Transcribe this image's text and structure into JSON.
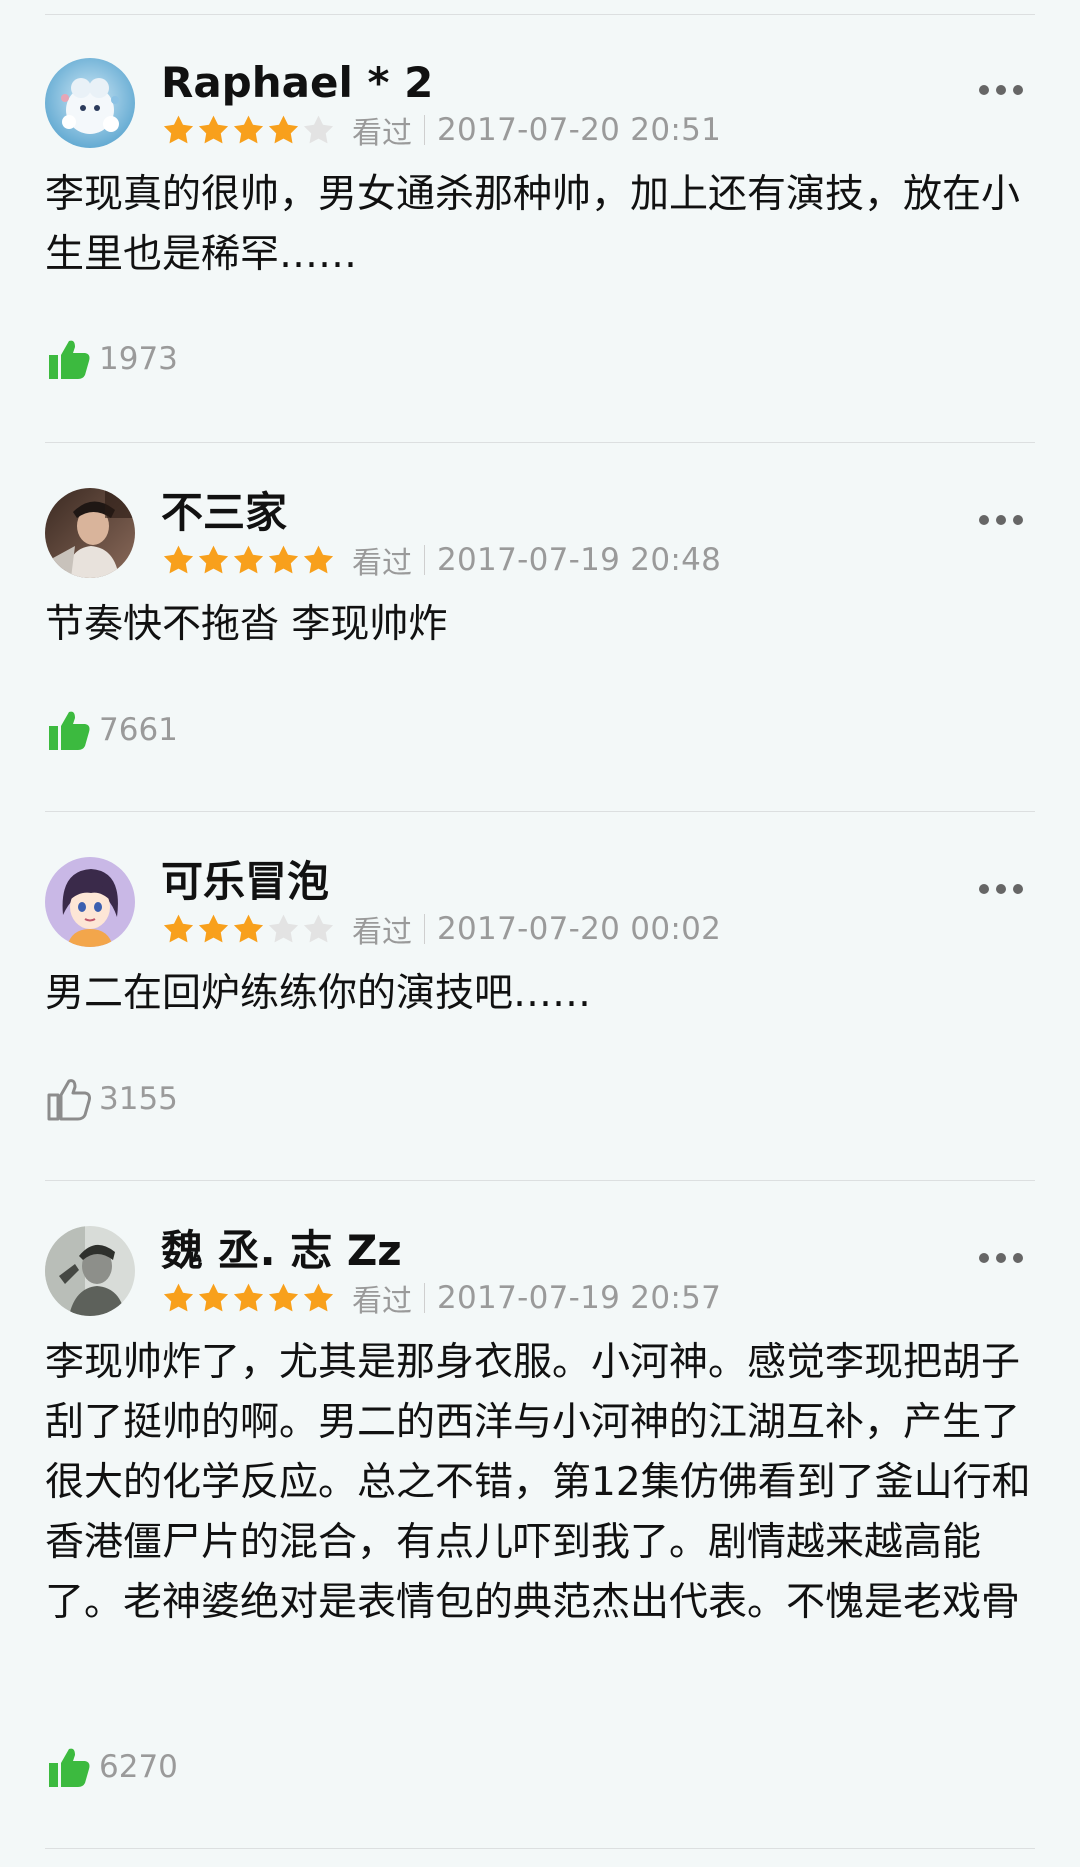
{
  "colors": {
    "star_filled": "#f8a01c",
    "star_empty": "#e3e3e3",
    "liked_green": "#3cba3f",
    "unliked_gray": "#8c8c8c"
  },
  "reviews": [
    {
      "username": "Raphael * 2",
      "rating": 4,
      "status": "看过",
      "date": "2017-07-20 20:51",
      "content": "李现真的很帅，男女通杀那种帅，加上还有演技，放在小生里也是稀罕……",
      "likes": "1973",
      "liked": true,
      "avatar_icon": "cartoon-character-avatar"
    },
    {
      "username": "不三家",
      "rating": 5,
      "status": "看过",
      "date": "2017-07-19 20:48",
      "content": "节奏快不拖沓 李现帅炸",
      "likes": "7661",
      "liked": true,
      "avatar_icon": "costume-character-avatar"
    },
    {
      "username": "可乐冒泡",
      "rating": 3,
      "status": "看过",
      "date": "2017-07-20 00:02",
      "content": "男二在回炉练练你的演技吧……",
      "likes": "3155",
      "liked": false,
      "avatar_icon": "anime-girl-avatar"
    },
    {
      "username": "魏 丞. 志 Zz",
      "rating": 5,
      "status": "看过",
      "date": "2017-07-19 20:57",
      "content": "李现帅炸了，尤其是那身衣服。小河神。感觉李现把胡子刮了挺帅的啊。男二的西洋与小河神的江湖互补，产生了很大的化学反应。总之不错，第12集仿佛看到了釜山行和香港僵尸片的混合，有点儿吓到我了。剧情越来越高能了。老神婆绝对是表情包的典范杰出代表。不愧是老戏骨",
      "likes": "6270",
      "liked": true,
      "avatar_icon": "grayscale-person-avatar"
    }
  ]
}
